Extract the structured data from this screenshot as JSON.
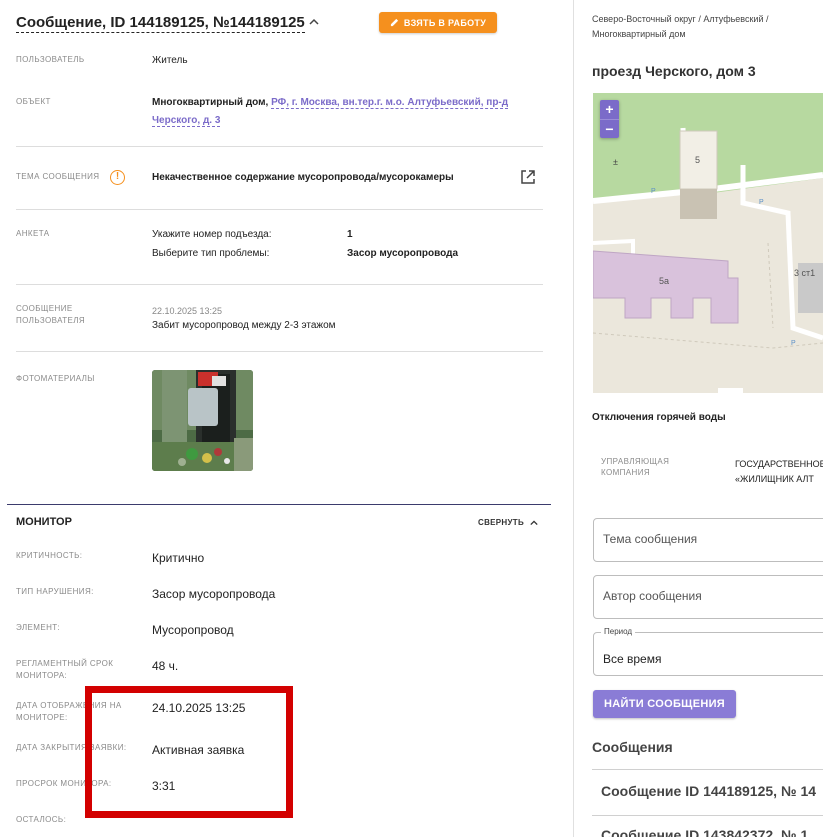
{
  "header": {
    "title": "Сообщение, ID 144189125, №144189125",
    "take_button": "ВЗЯТЬ В РАБОТУ"
  },
  "details": {
    "user_label": "ПОЛЬЗОВАТЕЛЬ",
    "user_value": "Житель",
    "object_label": "ОБЪЕКТ",
    "object_type": "Многоквартирный дом,",
    "object_link_line1": "РФ, г. Москва, вн.тер.г. м.о. Алтуфьевский, пр-д",
    "object_link_line2": "Черского, д. 3",
    "topic_label": "ТЕМА СООБЩЕНИЯ",
    "topic_value": "Некачественное содержание мусоропровода/мусорокамеры",
    "survey_label": "АНКЕТА",
    "survey_q1": "Укажите номер подъезда:",
    "survey_a1": "1",
    "survey_q2": "Выберите тип проблемы:",
    "survey_a2": "Засор мусоропровода",
    "usermsg_label_1": "СООБЩЕНИЕ",
    "usermsg_label_2": "ПОЛЬЗОВАТЕЛЯ",
    "usermsg_date": "22.10.2025 13:25",
    "usermsg_text": "Забит мусоропровод между 2-3 этажом",
    "photos_label": "ФОТОМАТЕРИАЛЫ"
  },
  "monitor": {
    "title": "МОНИТОР",
    "collapse": "СВЕРНУТЬ",
    "criticality_label": "КРИТИЧНОСТЬ:",
    "criticality_value": "Критично",
    "violation_label": "ТИП НАРУШЕНИЯ:",
    "violation_value": "Засор мусоропровода",
    "element_label": "ЭЛЕМЕНТ:",
    "element_value": "Мусоропровод",
    "deadline_label_1": "РЕГЛАМЕНТНЫЙ СРОК",
    "deadline_label_2": "МОНИТОРА:",
    "deadline_value": "48 ч.",
    "display_date_label_1": "ДАТА ОТОБРАЖЕНИЯ НА",
    "display_date_label_2": "МОНИТОРЕ:",
    "display_date_value": "24.10.2025 13:25",
    "close_date_label": "ДАТА ЗАКРЫТИЯ ЗАЯВКИ:",
    "close_date_value": "Активная заявка",
    "overdue_label": "ПРОСРОК МОНИТОРА:",
    "overdue_value": "3:31",
    "remaining_label": "ОСТАЛОСЬ:"
  },
  "right": {
    "breadcrumb_1": "Северо-Восточный округ / Алтуфьевский /",
    "breadcrumb_2": "Многоквартирный дом",
    "address": "проезд Черского, дом 3",
    "map": {
      "zoom_in": "+",
      "zoom_out": "−",
      "label_5": "5",
      "label_5a": "5а",
      "label_3st1": "3 ст1",
      "parking": "P"
    },
    "hot_water": "Отключения горячей воды",
    "mgmt_label_1": "УПРАВЛЯЮЩАЯ",
    "mgmt_label_2": "КОМПАНИЯ",
    "mgmt_value_1": "ГОСУДАРСТВЕННОЕ",
    "mgmt_value_2": "«ЖИЛИЩНИК АЛТ",
    "topic_placeholder": "Тема сообщения",
    "author_placeholder": "Автор сообщения",
    "period_legend": "Период",
    "period_value": "Все время",
    "find_button": "НАЙТИ СООБЩЕНИЯ",
    "messages_title": "Сообщения",
    "msg_1": "Сообщение ID 144189125, № 14",
    "msg_2": "Сообщение ID 143842372, № 1"
  },
  "colors": {
    "accent_orange": "#f5901e",
    "accent_purple": "#7b6bc9",
    "annotation_red": "#d30000"
  }
}
